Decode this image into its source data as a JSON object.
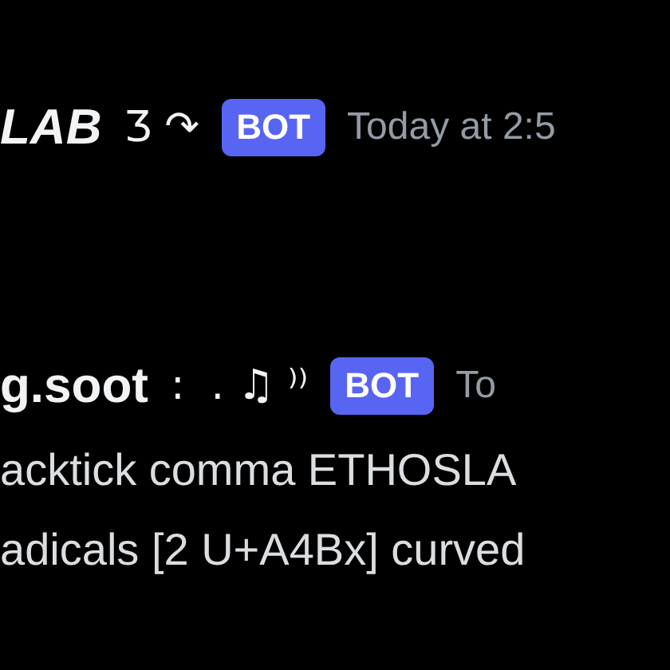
{
  "messages": [
    {
      "author": "LAB",
      "italic": true,
      "author_suffix": "Ʒ ↷",
      "badge": "BOT",
      "timestamp": "Today at 2:5"
    },
    {
      "author": "g.soot",
      "italic": false,
      "author_suffix": ":  . ♫ ⁾⁾",
      "badge": "BOT",
      "timestamp": "To",
      "lines": [
        "acktick comma ETHOSLA",
        "adicals [2 U+A4Bx] curved"
      ]
    }
  ]
}
